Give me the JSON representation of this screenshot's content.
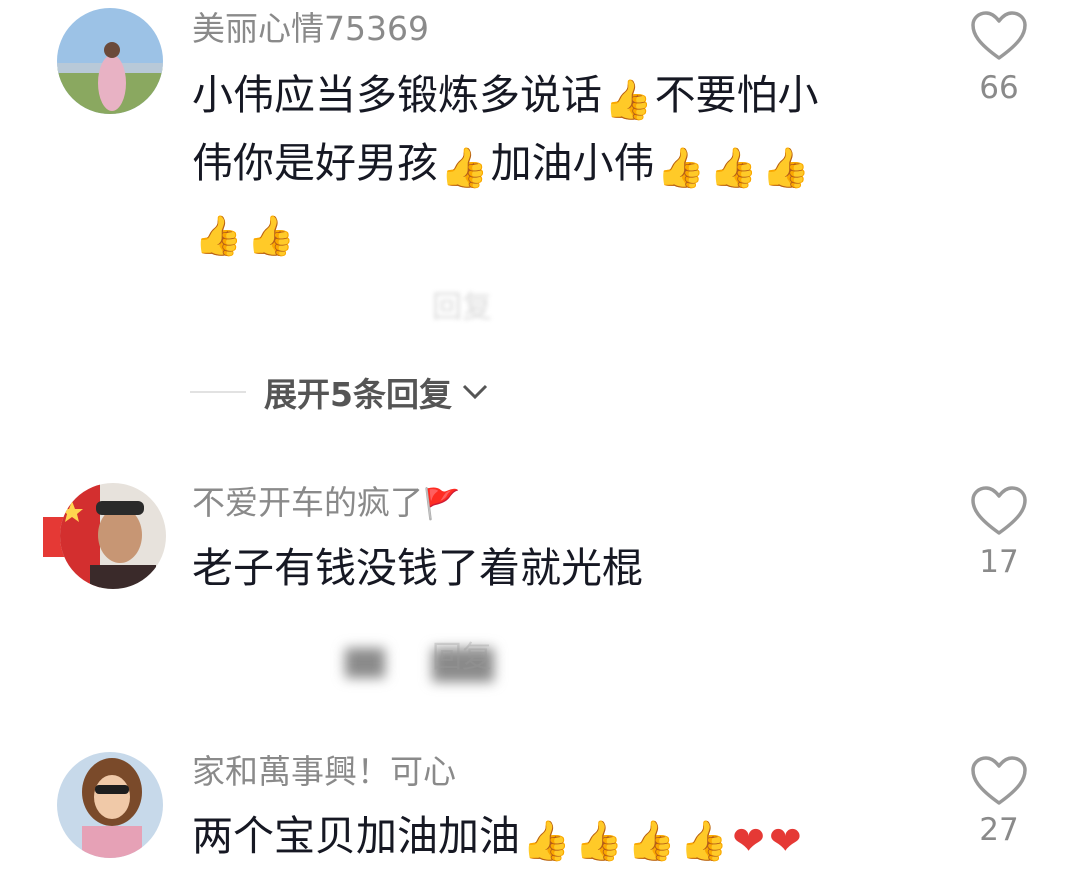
{
  "comments": [
    {
      "username": "美丽心情75369",
      "text_line1": "小伟应当多锻炼多说话",
      "text_line1b": "不要怕小",
      "text_line2": "伟你是好男孩",
      "text_line2b": "加油小伟",
      "likes": "66",
      "reply_label": "回复"
    },
    {
      "username": "不爱开车的疯了",
      "text": "老子有钱没钱了着就光棍",
      "likes": "17",
      "reply_label": "回复"
    },
    {
      "username": "家和萬事興！可心",
      "text": "两个宝贝加油加油",
      "likes": "27"
    }
  ],
  "expand_replies": "展开5条回复",
  "icons": {
    "thumbs_up": "👍",
    "heart_emoji": "❤",
    "flag": "🚩",
    "heart_outline": "heart-icon",
    "chevron": "chevron-down-icon"
  },
  "colors": {
    "username": "#8a8a8a",
    "text": "#161823",
    "count": "#8a8a8a"
  }
}
